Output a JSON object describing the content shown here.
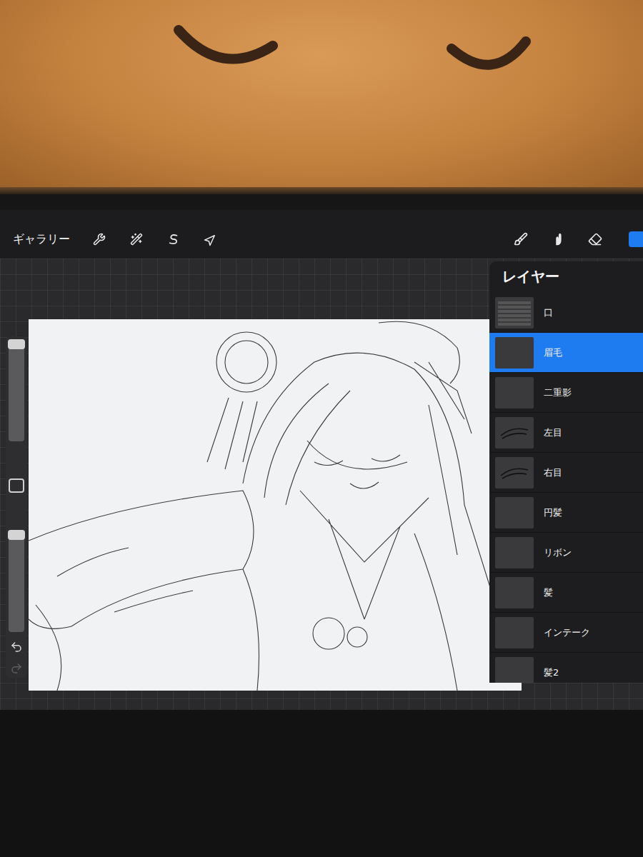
{
  "app": {
    "gallery_button": "ギャラリー"
  },
  "tools": [
    {
      "kind": "brush",
      "selected": false
    },
    {
      "kind": "smudge",
      "selected": false
    },
    {
      "kind": "eraser",
      "selected": false
    },
    {
      "kind": "layers",
      "selected": true
    }
  ],
  "sidebar": {
    "size_level": 1.0,
    "opacity_level": 1.0,
    "undo_disabled": false,
    "redo_disabled": true
  },
  "layers_panel": {
    "title": "レイヤー",
    "layers": [
      {
        "name": "口",
        "kind": "group",
        "selected": false
      },
      {
        "name": "眉毛",
        "kind": "plain",
        "selected": true
      },
      {
        "name": "二重影",
        "kind": "plain",
        "selected": false
      },
      {
        "name": "左目",
        "kind": "eyes",
        "selected": false
      },
      {
        "name": "右目",
        "kind": "eyes",
        "selected": false
      },
      {
        "name": "円髪",
        "kind": "plain",
        "selected": false
      },
      {
        "name": "リボン",
        "kind": "plain",
        "selected": false
      },
      {
        "name": "髪",
        "kind": "plain",
        "selected": false
      },
      {
        "name": "インテーク",
        "kind": "plain",
        "selected": false
      },
      {
        "name": "髪2",
        "kind": "plain",
        "selected": false
      }
    ]
  }
}
